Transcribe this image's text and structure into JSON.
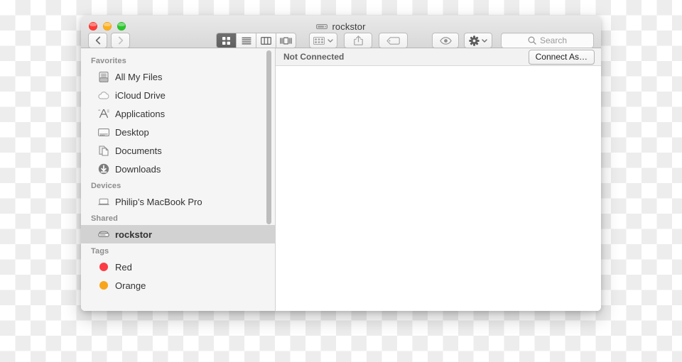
{
  "window": {
    "title": "rockstor",
    "title_icon": "server-drive-icon",
    "controls": {
      "close_label": "close",
      "minimize_label": "minimize",
      "zoom_label": "zoom"
    },
    "colors": {
      "close": "#ff3b36",
      "minimize": "#feae1b",
      "zoom": "#2ac62a",
      "selection": "#d2d2d2",
      "sidebar_bg": "#f5f5f5",
      "titlebar_top": "#e9e9e9",
      "titlebar_bottom": "#d8d8d8"
    }
  },
  "toolbar": {
    "back_label": "Back",
    "forward_label": "Forward",
    "view_modes": [
      {
        "name": "icon-view",
        "label": "Icon View",
        "active": true
      },
      {
        "name": "list-view",
        "label": "List View",
        "active": false
      },
      {
        "name": "column-view",
        "label": "Column View",
        "active": false
      },
      {
        "name": "coverflow-view",
        "label": "Cover Flow View",
        "active": false
      }
    ],
    "arrange_label": "Arrange By",
    "share_label": "Share",
    "tag_label": "Edit Tags",
    "quicklook_label": "Quick Look",
    "action_label": "Action",
    "search": {
      "value": "",
      "placeholder": "Search"
    }
  },
  "sidebar": {
    "sections": [
      {
        "header": "Favorites",
        "items": [
          {
            "label": "All My Files",
            "icon": "all-my-files-icon",
            "selected": false
          },
          {
            "label": "iCloud Drive",
            "icon": "icloud-icon",
            "selected": false
          },
          {
            "label": "Applications",
            "icon": "applications-icon",
            "selected": false
          },
          {
            "label": "Desktop",
            "icon": "desktop-icon",
            "selected": false
          },
          {
            "label": "Documents",
            "icon": "documents-icon",
            "selected": false
          },
          {
            "label": "Downloads",
            "icon": "downloads-icon",
            "selected": false
          }
        ]
      },
      {
        "header": "Devices",
        "items": [
          {
            "label": "Philip’s MacBook Pro",
            "icon": "laptop-icon",
            "selected": false
          }
        ]
      },
      {
        "header": "Shared",
        "items": [
          {
            "label": "rockstor",
            "icon": "server-drive-icon",
            "selected": true
          }
        ]
      },
      {
        "header": "Tags",
        "items": [
          {
            "label": "Red",
            "icon": "tag-dot-icon",
            "color": "#fc3b44",
            "selected": false
          },
          {
            "label": "Orange",
            "icon": "tag-dot-icon",
            "color": "#f8a51c",
            "selected": false
          }
        ]
      }
    ]
  },
  "content": {
    "status": "Not Connected",
    "connect_button": "Connect As…",
    "files": []
  }
}
